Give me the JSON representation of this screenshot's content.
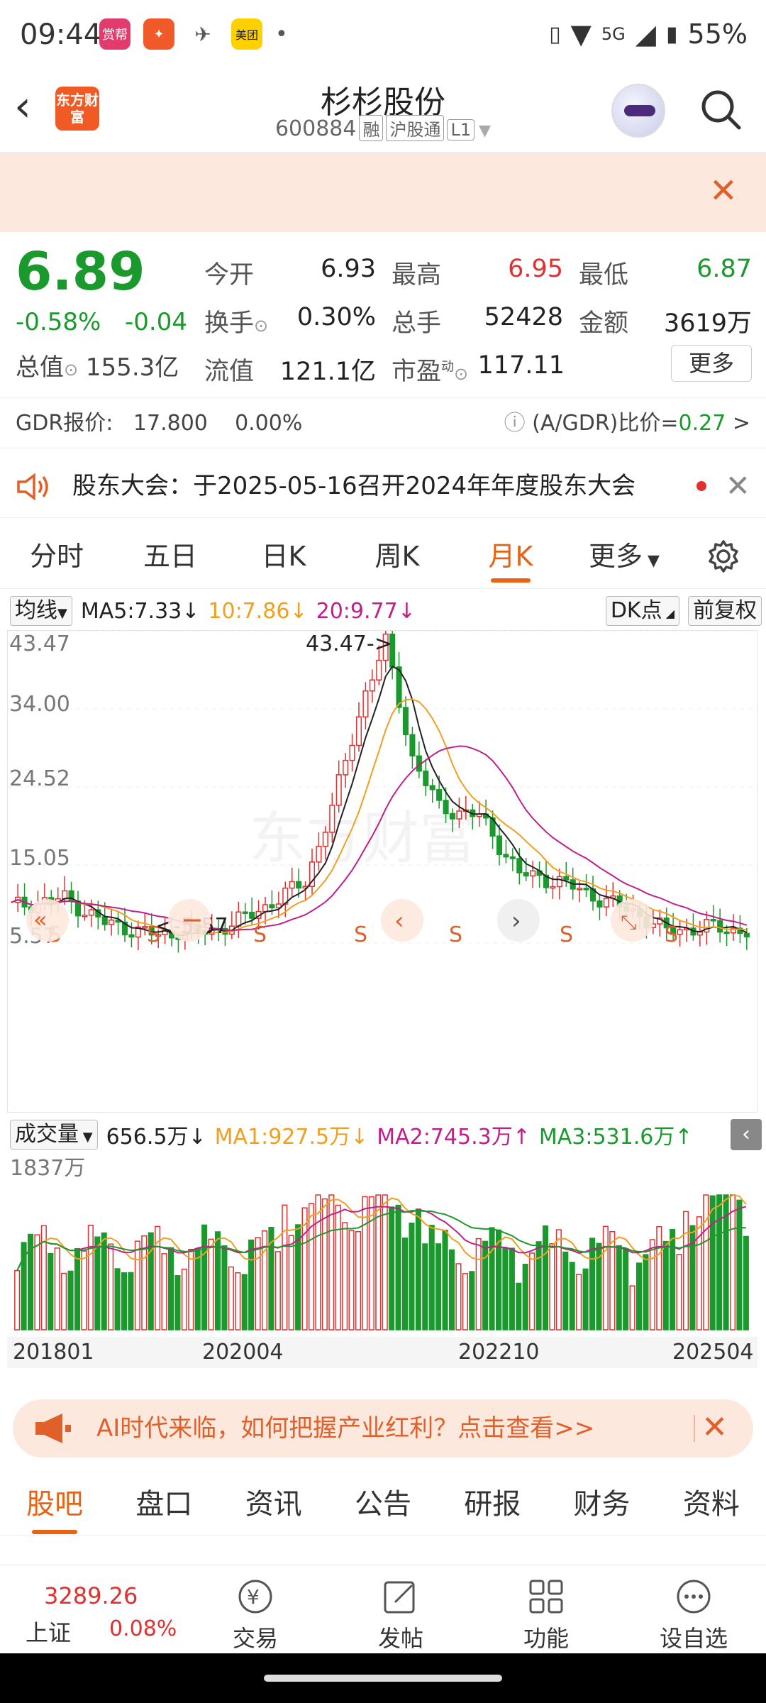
{
  "status": {
    "time": "09:44",
    "apps": [
      "赏帮",
      "",
      "",
      "美团"
    ],
    "dot": "•",
    "network": "5G",
    "battery": "55%"
  },
  "header": {
    "name": "杉杉股份",
    "code": "600884",
    "tags": [
      "融",
      "沪股通",
      "L1"
    ],
    "logo": "东方财富"
  },
  "quote": {
    "price": "6.89",
    "change_pct": "-0.58%",
    "change": "-0.04",
    "rows": [
      [
        {
          "label": "今开",
          "value": "6.93"
        },
        {
          "label": "最高",
          "value": "6.95"
        },
        {
          "label": "最低",
          "value": "6.87"
        }
      ],
      [
        {
          "label": "换手",
          "value": "0.30%"
        },
        {
          "label": "总手",
          "value": "52428"
        },
        {
          "label": "金额",
          "value": "3619万"
        }
      ],
      [
        {
          "label": "流值",
          "value": "121.1亿"
        },
        {
          "label": "市盈",
          "value": "117.11"
        }
      ]
    ],
    "total_value_label": "总值",
    "total_value": "155.3亿",
    "pe_sup": "动",
    "more": "更多"
  },
  "gdr": {
    "label": "GDR报价:",
    "price": "17.800",
    "pct": "0.00%",
    "ratio_label": "(A/GDR)比价=",
    "ratio": "0.27",
    "arrow": ">"
  },
  "notice": {
    "text": "股东大会：于2025-05-16召开2024年年度股东大会"
  },
  "tabs": [
    "分时",
    "五日",
    "日K",
    "周K",
    "月K",
    "更多"
  ],
  "active_tab": "月K",
  "ma": {
    "selector": "均线",
    "ma5": "MA5:7.33",
    "ma10": "10:7.86",
    "ma20": "20:9.77",
    "dk": "DK点",
    "adjust": "前复权"
  },
  "chart_data": {
    "type": "candlestick",
    "y_ticks": [
      "43.47",
      "34.00",
      "24.52",
      "15.05",
      "5.57"
    ],
    "ylim": [
      5.57,
      43.47
    ],
    "annotations": [
      "43.47->",
      "<-5.57"
    ],
    "marks": [
      "S",
      "S",
      "S",
      "S",
      "S",
      "S",
      "S"
    ],
    "watermark": "东方财富",
    "colors": {
      "up": "#e03030",
      "down": "#1a9a2c",
      "ma5": "#222222",
      "ma10": "#f0a020",
      "ma20": "#c0208a"
    }
  },
  "volume": {
    "selector": "成交量",
    "current": "656.5万",
    "ma1": "MA1:927.5万",
    "ma2": "MA2:745.3万",
    "ma3": "MA3:531.6万",
    "max_label": "1837万"
  },
  "x_labels": [
    "201801",
    "202004",
    "202210",
    "202504"
  ],
  "ad": {
    "text": "AI时代来临，如何把握产业红利？点击查看>>"
  },
  "bottom_tabs": [
    "股吧",
    "盘口",
    "资讯",
    "公告",
    "研报",
    "财务",
    "资料"
  ],
  "active_bottom_tab": "股吧",
  "bottom_bar": {
    "index_value": "3289.26",
    "index_name": "上证",
    "index_pct": "0.08%",
    "items": [
      "交易",
      "发帖",
      "功能",
      "设自选"
    ]
  }
}
